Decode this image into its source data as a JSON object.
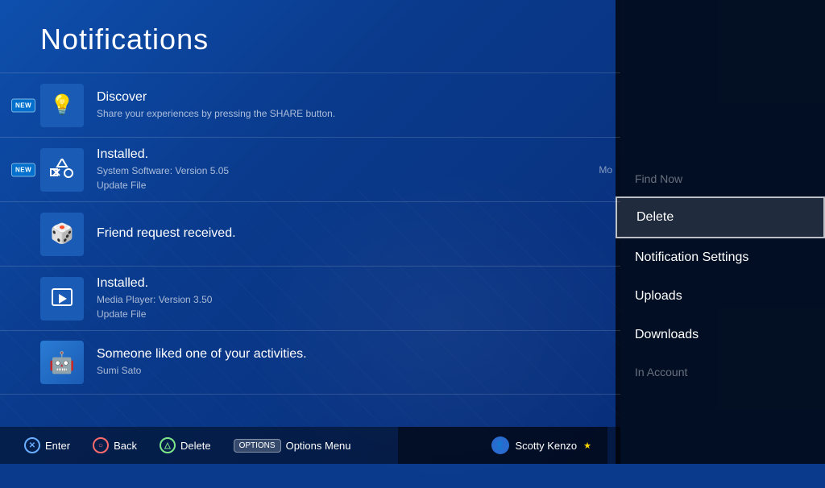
{
  "page": {
    "title": "Notifications"
  },
  "notifications": [
    {
      "id": "discover",
      "isNew": true,
      "iconType": "bulb",
      "title": "Discover",
      "subtitle": "Share your experiences by pressing the SHARE button.",
      "subtitle2": null,
      "hasMore": false
    },
    {
      "id": "installed-system",
      "isNew": true,
      "iconType": "ps4-symbols",
      "title": "Installed.",
      "subtitle": "System Software: Version 5.05",
      "subtitle2": "Update File",
      "hasMore": true
    },
    {
      "id": "friend-request",
      "isNew": false,
      "iconType": "dice",
      "title": "Friend request received.",
      "subtitle": null,
      "subtitle2": null,
      "hasMore": false
    },
    {
      "id": "installed-media",
      "isNew": false,
      "iconType": "play",
      "title": "Installed.",
      "subtitle": "Media Player: Version 3.50",
      "subtitle2": "Update File",
      "hasMore": false
    },
    {
      "id": "activity-liked",
      "isNew": false,
      "iconType": "astro",
      "title": "Someone liked one of your activities.",
      "subtitle": "Sumi Sato",
      "subtitle2": null,
      "hasMore": false
    }
  ],
  "context_menu": {
    "items": [
      {
        "id": "delete",
        "label": "Delete",
        "selected": true
      },
      {
        "id": "notification-settings",
        "label": "Notification Settings",
        "selected": false
      },
      {
        "id": "uploads",
        "label": "Uploads",
        "selected": false
      },
      {
        "id": "downloads",
        "label": "Downloads",
        "selected": false
      }
    ],
    "dimmed_above": "Find Now",
    "dimmed_below": "In Account"
  },
  "bottom_bar": {
    "actions": [
      {
        "id": "enter",
        "button": "X",
        "label": "Enter",
        "color": "blue"
      },
      {
        "id": "back",
        "button": "O",
        "label": "Back",
        "color": "red"
      },
      {
        "id": "delete",
        "button": "△",
        "label": "Delete",
        "color": "green"
      },
      {
        "id": "options",
        "label": "Options Menu",
        "isOptions": true
      }
    ]
  },
  "user": {
    "name": "Scotty Kenzo",
    "hasStar": true,
    "star": "★"
  },
  "new_badge_text": "NEW"
}
